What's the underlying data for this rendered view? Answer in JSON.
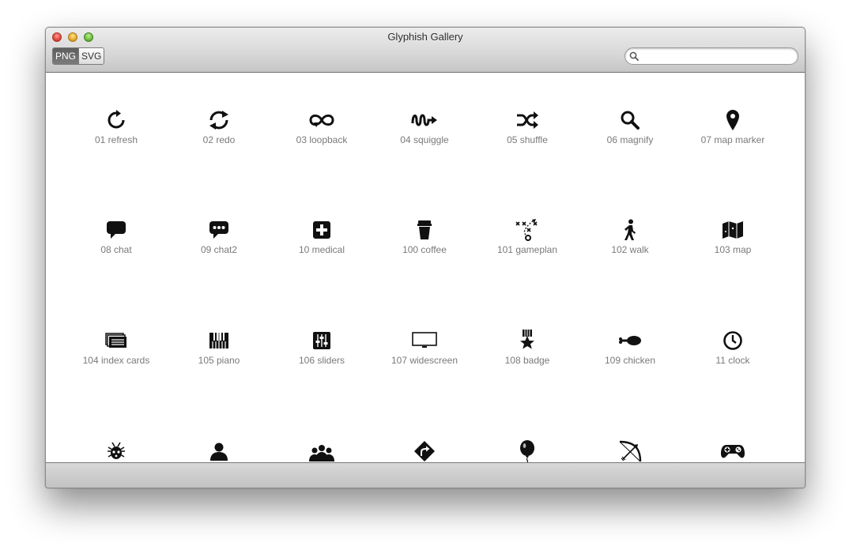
{
  "window": {
    "title": "Glyphish Gallery"
  },
  "toolbar": {
    "format_png": "PNG",
    "format_svg": "SVG",
    "search_placeholder": ""
  },
  "gallery": {
    "items": [
      {
        "label": "01 refresh",
        "icon": "refresh-icon"
      },
      {
        "label": "02 redo",
        "icon": "redo-icon"
      },
      {
        "label": "03 loopback",
        "icon": "loopback-icon"
      },
      {
        "label": "04 squiggle",
        "icon": "squiggle-icon"
      },
      {
        "label": "05 shuffle",
        "icon": "shuffle-icon"
      },
      {
        "label": "06 magnify",
        "icon": "magnify-icon"
      },
      {
        "label": "07 map marker",
        "icon": "map-marker-icon"
      },
      {
        "label": "08 chat",
        "icon": "chat-icon"
      },
      {
        "label": "09 chat2",
        "icon": "chat2-icon"
      },
      {
        "label": "10 medical",
        "icon": "medical-icon"
      },
      {
        "label": "100 coffee",
        "icon": "coffee-icon"
      },
      {
        "label": "101 gameplan",
        "icon": "gameplan-icon"
      },
      {
        "label": "102 walk",
        "icon": "walk-icon"
      },
      {
        "label": "103 map",
        "icon": "map-icon"
      },
      {
        "label": "104 index cards",
        "icon": "index-cards-icon"
      },
      {
        "label": "105 piano",
        "icon": "piano-icon"
      },
      {
        "label": "106 sliders",
        "icon": "sliders-icon"
      },
      {
        "label": "107 widescreen",
        "icon": "widescreen-icon"
      },
      {
        "label": "108 badge",
        "icon": "badge-icon"
      },
      {
        "label": "109 chicken",
        "icon": "chicken-icon"
      },
      {
        "label": "11 clock",
        "icon": "clock-icon"
      },
      {
        "label": "",
        "icon": "bug-icon"
      },
      {
        "label": "",
        "icon": "person-icon"
      },
      {
        "label": "",
        "icon": "group-icon"
      },
      {
        "label": "",
        "icon": "road-sign-icon"
      },
      {
        "label": "",
        "icon": "balloon-icon"
      },
      {
        "label": "",
        "icon": "bow-arrow-icon"
      },
      {
        "label": "",
        "icon": "gamepad-icon"
      }
    ]
  }
}
